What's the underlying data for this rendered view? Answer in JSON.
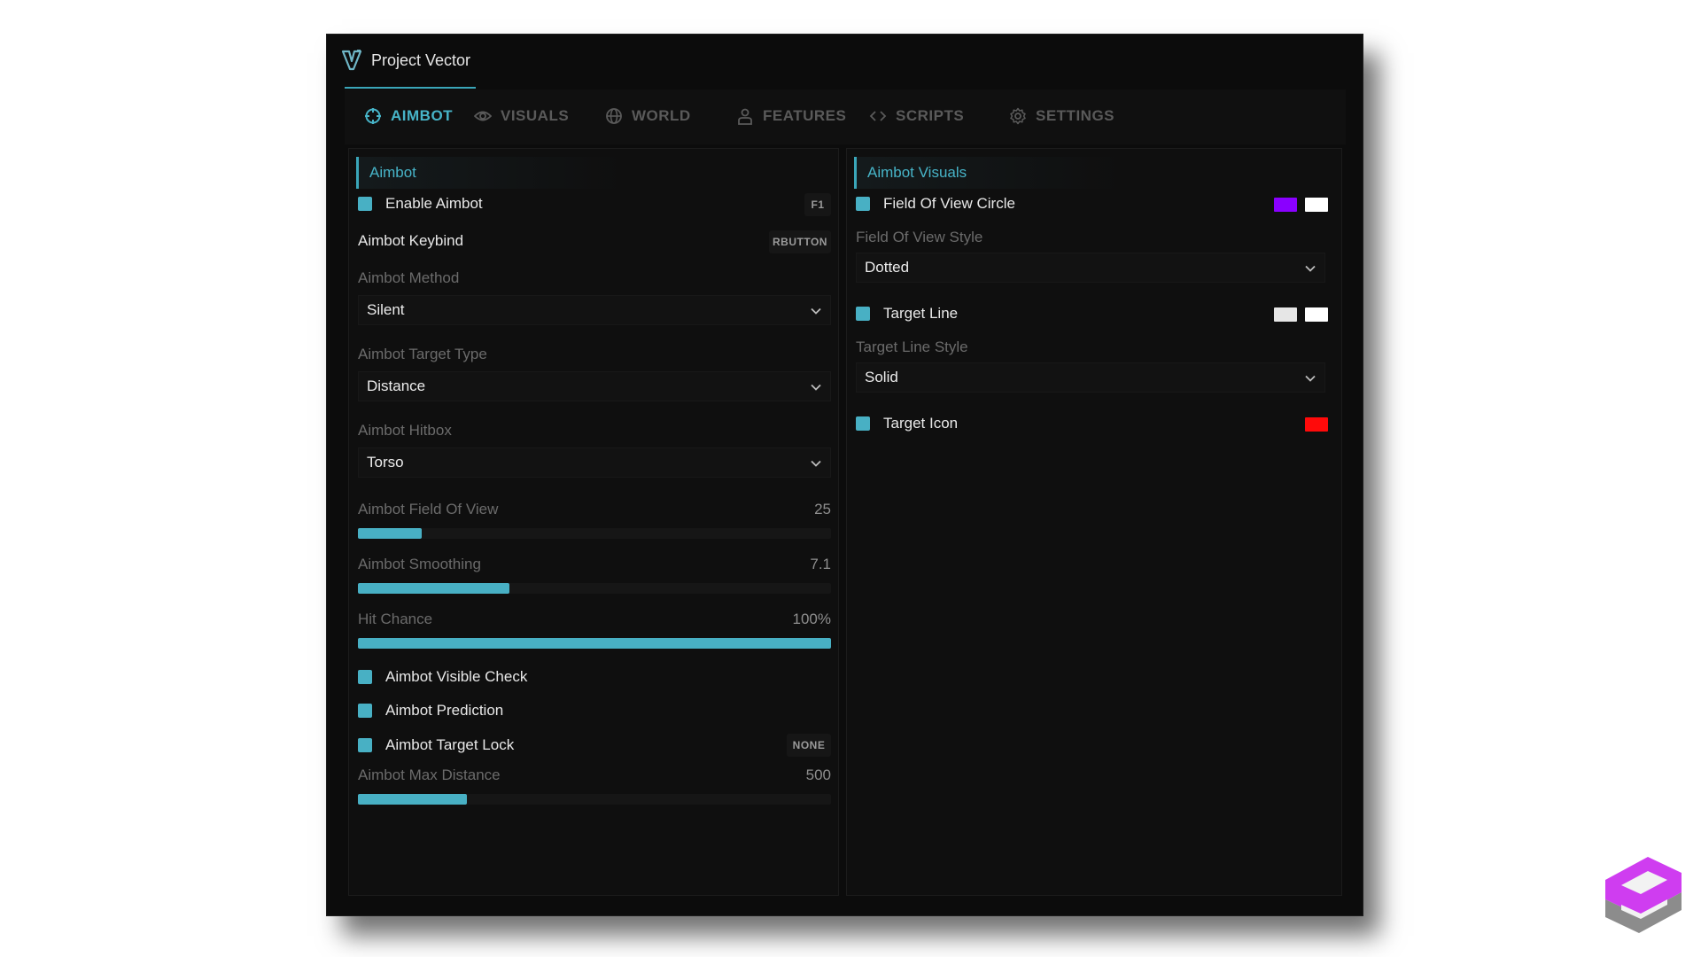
{
  "window": {
    "title": "Project Vector"
  },
  "tabs": [
    {
      "label": "AIMBOT",
      "icon": "crosshair-icon",
      "active": true
    },
    {
      "label": "VISUALS",
      "icon": "eye-icon",
      "active": false
    },
    {
      "label": "WORLD",
      "icon": "globe-icon",
      "active": false
    },
    {
      "label": "FEATURES",
      "icon": "user-icon",
      "active": false
    },
    {
      "label": "SCRIPTS",
      "icon": "code-icon",
      "active": false
    },
    {
      "label": "SETTINGS",
      "icon": "gear-icon",
      "active": false
    }
  ],
  "aimbot": {
    "header": "Aimbot",
    "enable": {
      "label": "Enable Aimbot",
      "key": "F1",
      "checked": true
    },
    "keybind": {
      "label": "Aimbot Keybind",
      "key": "RBUTTON"
    },
    "method": {
      "label": "Aimbot Method",
      "value": "Silent"
    },
    "target_type": {
      "label": "Aimbot Target Type",
      "value": "Distance"
    },
    "hitbox": {
      "label": "Aimbot Hitbox",
      "value": "Torso"
    },
    "fov": {
      "label": "Aimbot Field Of View",
      "value": "25",
      "fraction": 0.135
    },
    "smoothing": {
      "label": "Aimbot Smoothing",
      "value": "7.1",
      "fraction": 0.32
    },
    "hit_chance": {
      "label": "Hit Chance",
      "value": "100%",
      "fraction": 1.0
    },
    "visible_check": {
      "label": "Aimbot Visible Check",
      "checked": true
    },
    "prediction": {
      "label": "Aimbot Prediction",
      "checked": true
    },
    "target_lock": {
      "label": "Aimbot Target Lock",
      "key": "NONE",
      "checked": true
    },
    "max_distance": {
      "label": "Aimbot Max Distance",
      "value": "500",
      "fraction": 0.23
    }
  },
  "visuals": {
    "header": "Aimbot Visuals",
    "fov_circle": {
      "label": "Field Of View Circle",
      "checked": true,
      "colors": [
        "#8a00ff",
        "#ffffff"
      ]
    },
    "fov_style": {
      "label": "Field Of View Style",
      "value": "Dotted"
    },
    "target_line": {
      "label": "Target Line",
      "checked": true,
      "colors": [
        "#e6e6e6",
        "#ffffff"
      ]
    },
    "target_line_style": {
      "label": "Target Line Style",
      "value": "Solid"
    },
    "target_icon": {
      "label": "Target Icon",
      "checked": true,
      "colors": [
        "#ff0a0a"
      ]
    }
  },
  "theme": {
    "accent": "#48b0c4",
    "background": "#0c0c0c"
  }
}
